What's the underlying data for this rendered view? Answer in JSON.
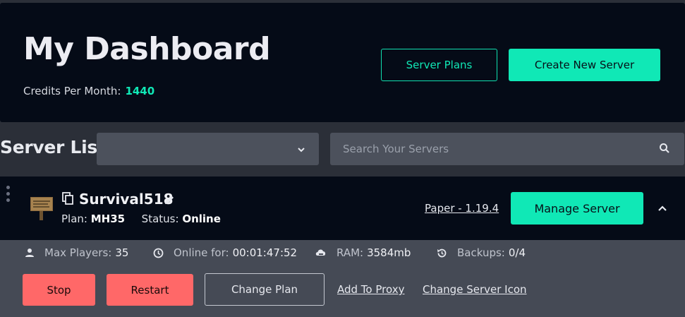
{
  "header": {
    "title": "My Dashboard",
    "credits_label": "Credits Per Month:",
    "credits_value": "1440",
    "server_plans_label": "Server Plans",
    "create_server_label": "Create New Server"
  },
  "toolbar": {
    "list_title": "Server List",
    "filter_value": "",
    "search_placeholder": "Search Your Servers",
    "icons": [
      "chevron-down-icon",
      "search-icon"
    ]
  },
  "server": {
    "name": "Survival518",
    "plan_label": "Plan:",
    "plan_value": "MH35",
    "status_label": "Status:",
    "status_value": "Online",
    "version": "Paper - 1.19.4",
    "manage_label": "Manage Server",
    "stats": {
      "max_players_label": "Max Players:",
      "max_players_value": "35",
      "online_for_label": "Online for:",
      "online_for_value": "00:01:47:52",
      "ram_label": "RAM:",
      "ram_value": "3584mb",
      "backups_label": "Backups:",
      "backups_value": "0/4"
    },
    "actions": {
      "stop": "Stop",
      "restart": "Restart",
      "change_plan": "Change Plan",
      "add_to_proxy": "Add To Proxy",
      "change_icon": "Change Server Icon"
    },
    "icons": [
      "drag-handle-icon",
      "server-sign-icon",
      "copy-icon",
      "edit-icon",
      "chevron-up-icon",
      "user-icon",
      "clock-icon",
      "ram-icon",
      "backup-icon"
    ]
  },
  "colors": {
    "accent": "#10e8b6",
    "danger": "#ff6868",
    "card_bg": "#050b17",
    "page_bg": "#2b2f38",
    "panel_bg": "#454a55"
  }
}
